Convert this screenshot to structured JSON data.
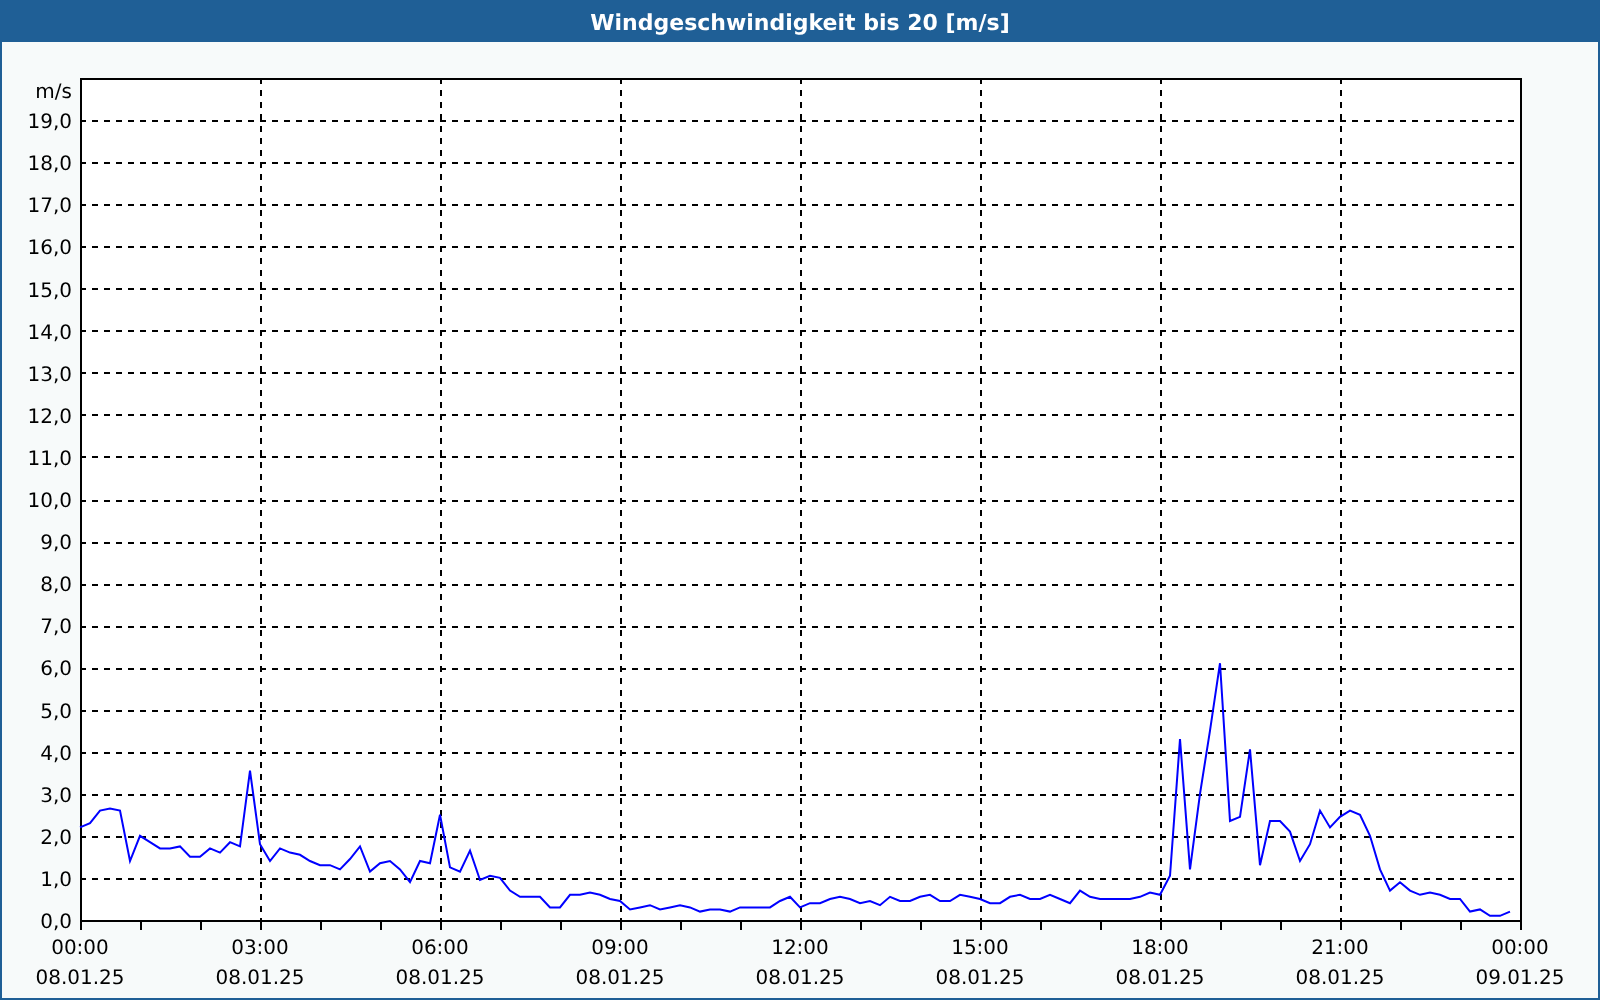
{
  "window": {
    "title": "Windgeschwindigkeit bis 20 [m/s]"
  },
  "chart": {
    "chart_data": {
      "type": "line",
      "grid": true,
      "ylabel": "m/s",
      "ylim": [
        0,
        20
      ],
      "yticks": [
        {
          "value": 0,
          "label": "0,0"
        },
        {
          "value": 1,
          "label": "1,0"
        },
        {
          "value": 2,
          "label": "2,0"
        },
        {
          "value": 3,
          "label": "3,0"
        },
        {
          "value": 4,
          "label": "4,0"
        },
        {
          "value": 5,
          "label": "5,0"
        },
        {
          "value": 6,
          "label": "6,0"
        },
        {
          "value": 7,
          "label": "7,0"
        },
        {
          "value": 8,
          "label": "8,0"
        },
        {
          "value": 9,
          "label": "9,0"
        },
        {
          "value": 10,
          "label": "10,0"
        },
        {
          "value": 11,
          "label": "11,0"
        },
        {
          "value": 12,
          "label": "12,0"
        },
        {
          "value": 13,
          "label": "13,0"
        },
        {
          "value": 14,
          "label": "14,0"
        },
        {
          "value": 15,
          "label": "15,0"
        },
        {
          "value": 16,
          "label": "16,0"
        },
        {
          "value": 17,
          "label": "17,0"
        },
        {
          "value": 18,
          "label": "18,0"
        },
        {
          "value": 19,
          "label": "19,0"
        }
      ],
      "categories": [
        "00:00 08.01.25",
        null,
        null,
        null,
        null,
        null,
        null,
        null,
        null,
        null,
        null,
        null,
        null,
        null,
        null,
        null,
        null,
        null,
        "03:00 08.01.25",
        null,
        null,
        null,
        null,
        null,
        null,
        null,
        null,
        null,
        null,
        null,
        null,
        null,
        null,
        null,
        null,
        null,
        "06:00 08.01.25",
        null,
        null,
        null,
        null,
        null,
        null,
        null,
        null,
        null,
        null,
        null,
        null,
        null,
        null,
        null,
        null,
        null,
        "09:00 08.01.25",
        null,
        null,
        null,
        null,
        null,
        null,
        null,
        null,
        null,
        null,
        null,
        null,
        null,
        null,
        null,
        null,
        null,
        "12:00 08.01.25",
        null,
        null,
        null,
        null,
        null,
        null,
        null,
        null,
        null,
        null,
        null,
        null,
        null,
        null,
        null,
        null,
        null,
        "15:00 08.01.25",
        null,
        null,
        null,
        null,
        null,
        null,
        null,
        null,
        null,
        null,
        null,
        null,
        null,
        null,
        null,
        null,
        null,
        "18:00 08.01.25",
        null,
        null,
        null,
        null,
        null,
        null,
        null,
        null,
        null,
        null,
        null,
        null,
        null,
        null,
        null,
        null,
        null,
        "21:00 08.01.25",
        null,
        null,
        null,
        null,
        null,
        null,
        null,
        null,
        null,
        null,
        null,
        null,
        null,
        null,
        null,
        null,
        null,
        "00:00 09.01.25"
      ],
      "series": [
        {
          "color": "#0000ff",
          "values": [
            2.2,
            2.3,
            2.6,
            2.65,
            2.6,
            1.4,
            2.0,
            1.85,
            1.7,
            1.7,
            1.75,
            1.5,
            1.5,
            1.7,
            1.6,
            1.85,
            1.75,
            3.55,
            1.8,
            1.4,
            1.7,
            1.6,
            1.55,
            1.4,
            1.3,
            1.3,
            1.2,
            1.45,
            1.75,
            1.15,
            1.35,
            1.4,
            1.2,
            0.9,
            1.4,
            1.35,
            2.5,
            1.25,
            1.15,
            1.65,
            0.95,
            1.05,
            1.0,
            0.7,
            0.55,
            0.55,
            0.55,
            0.3,
            0.3,
            0.6,
            0.6,
            0.65,
            0.6,
            0.5,
            0.45,
            0.25,
            0.3,
            0.35,
            0.25,
            0.3,
            0.35,
            0.3,
            0.2,
            0.25,
            0.25,
            0.2,
            0.3,
            0.3,
            0.3,
            0.3,
            0.45,
            0.55,
            0.3,
            0.4,
            0.4,
            0.5,
            0.55,
            0.5,
            0.4,
            0.45,
            0.35,
            0.55,
            0.45,
            0.45,
            0.55,
            0.6,
            0.45,
            0.45,
            0.6,
            0.55,
            0.5,
            0.4,
            0.4,
            0.55,
            0.6,
            0.5,
            0.5,
            0.6,
            0.5,
            0.4,
            0.7,
            0.55,
            0.5,
            0.5,
            0.5,
            0.5,
            0.55,
            0.65,
            0.6,
            1.05,
            4.3,
            1.2,
            3.0,
            4.5,
            6.1,
            2.35,
            2.45,
            4.05,
            1.3,
            2.35,
            2.35,
            2.1,
            1.4,
            1.8,
            2.6,
            2.2,
            2.45,
            2.6,
            2.5,
            2.0,
            1.2,
            0.7,
            0.9,
            0.7,
            0.6,
            0.65,
            0.6,
            0.5,
            0.5,
            0.2,
            0.25,
            0.1,
            0.1,
            0.2,
            null
          ]
        }
      ]
    }
  }
}
